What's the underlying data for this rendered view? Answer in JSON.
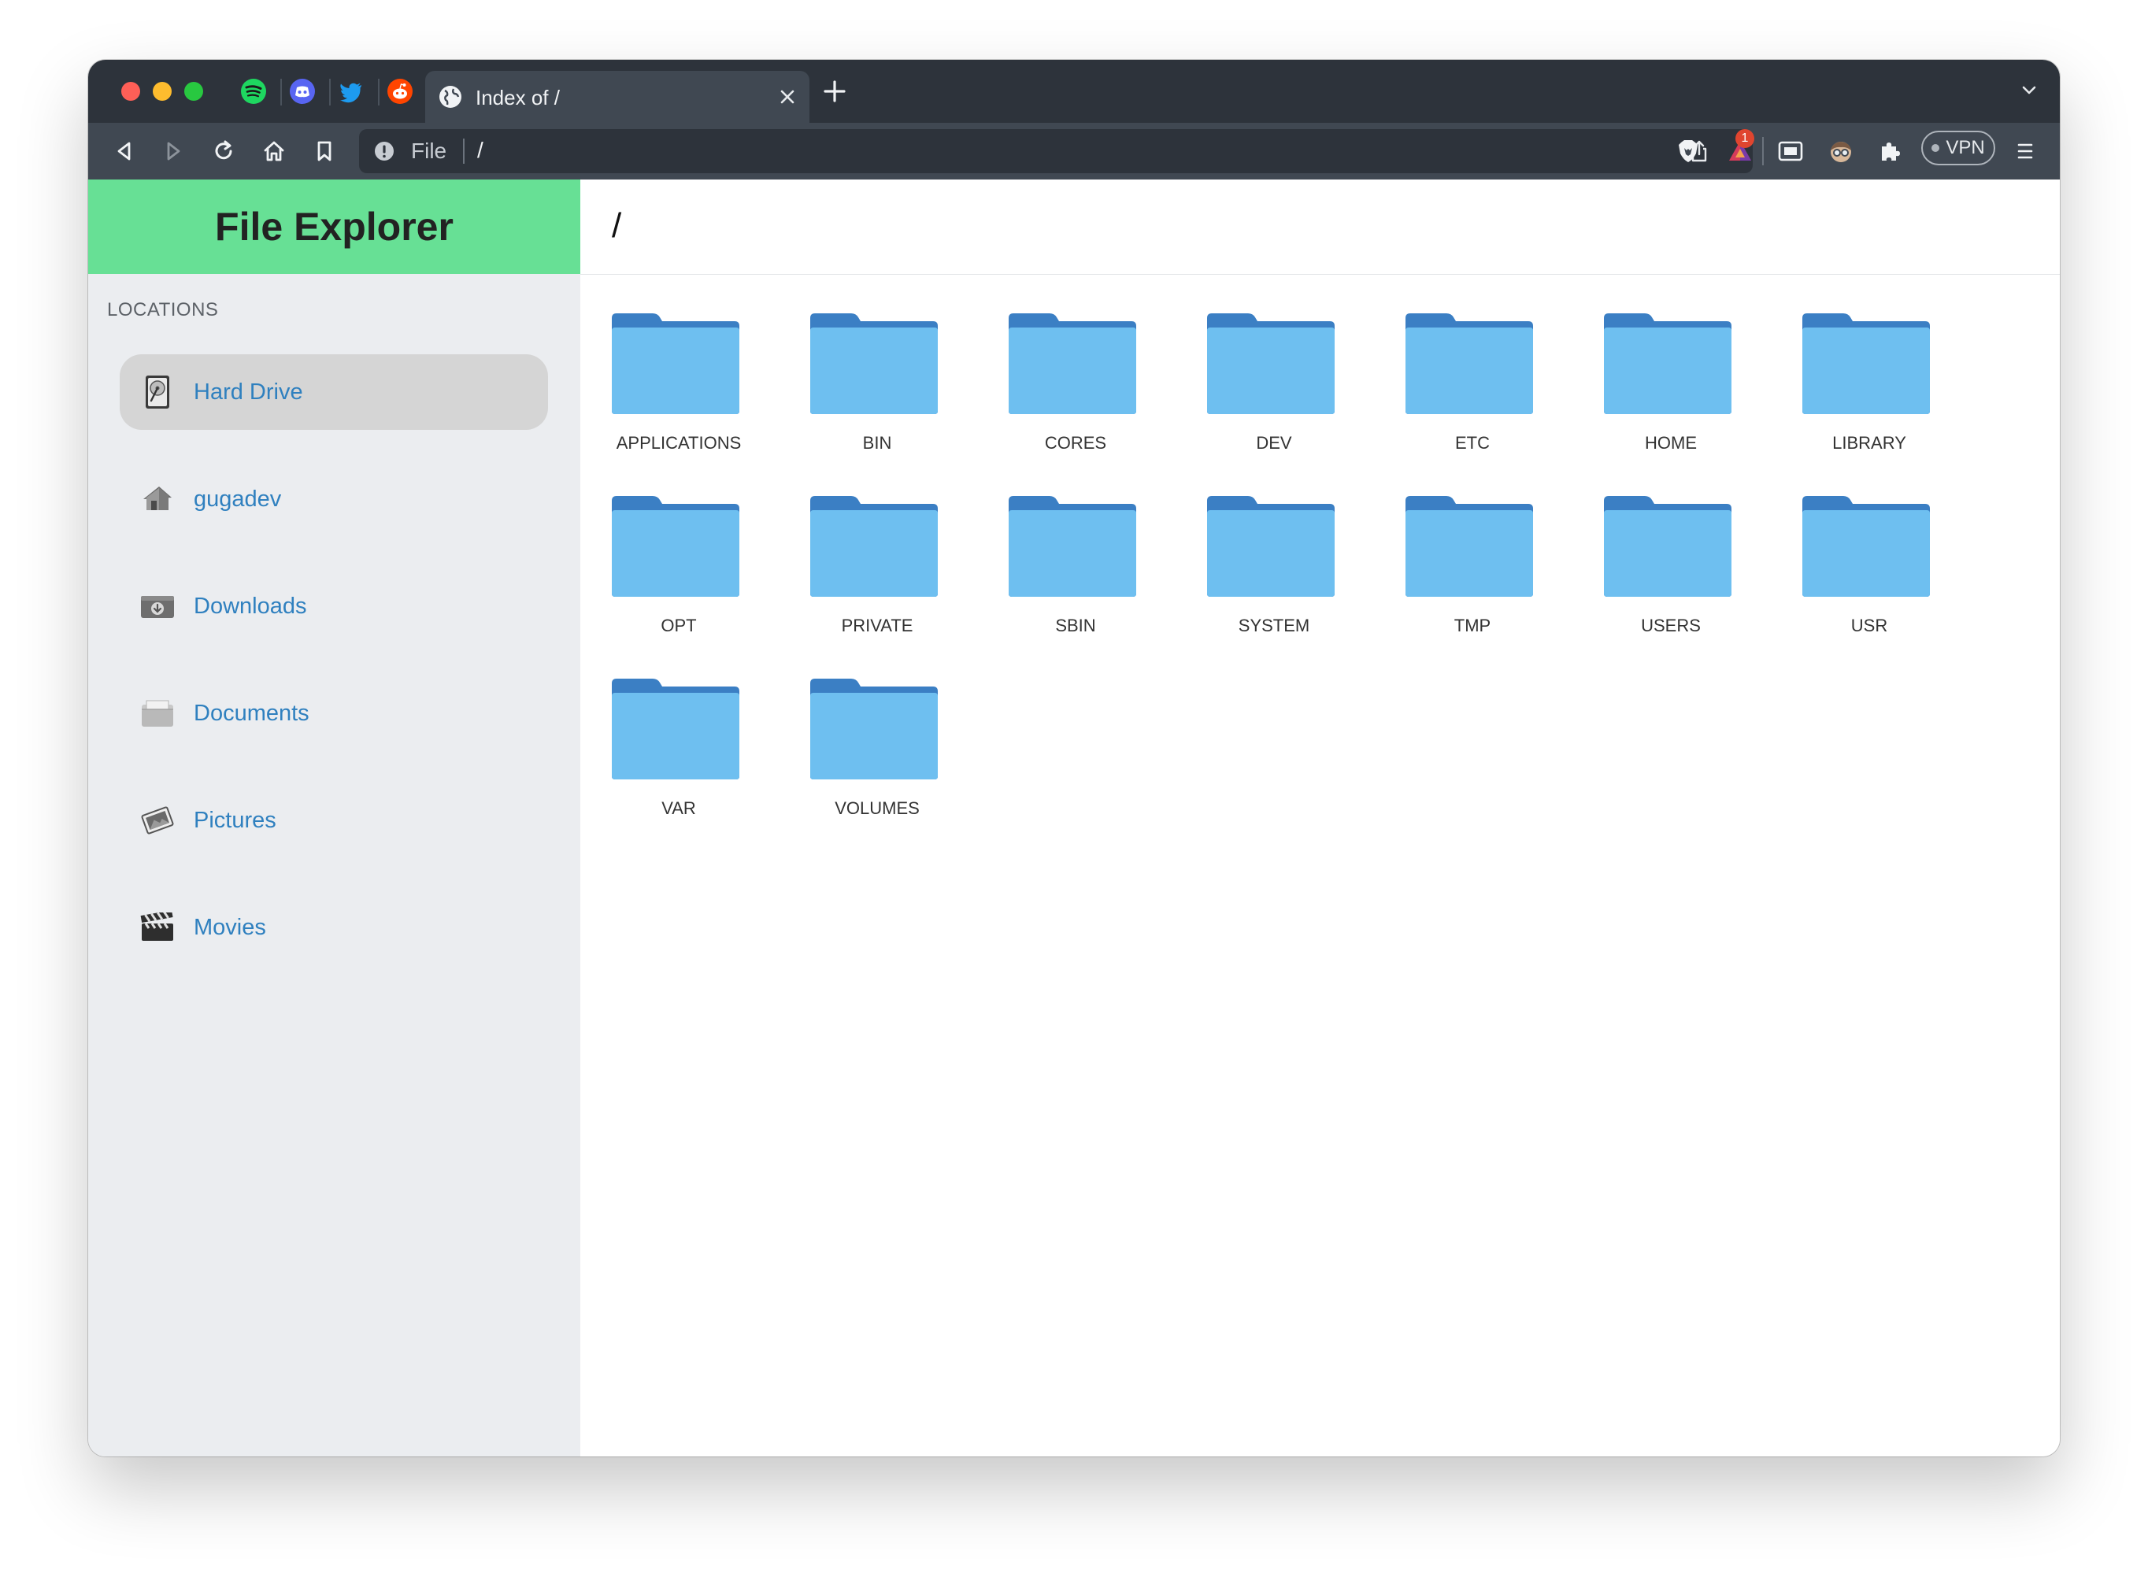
{
  "browser": {
    "pinned_tabs": [
      {
        "name": "spotify-tab",
        "icon": "spotify-icon",
        "color": "#1ed760"
      },
      {
        "name": "discord-tab",
        "icon": "discord-icon",
        "color": "#5865f2"
      },
      {
        "name": "twitter-tab",
        "icon": "twitter-icon",
        "color": "#1d9bf0"
      },
      {
        "name": "reddit-tab",
        "icon": "reddit-icon",
        "color": "#ff4500"
      }
    ],
    "active_tab": {
      "title": "Index of /",
      "icon": "globe-icon"
    },
    "url": {
      "scheme": "File",
      "path": "/"
    },
    "notification_count": "1",
    "vpn_label": "VPN"
  },
  "sidebar": {
    "title": "File Explorer",
    "section_heading": "LOCATIONS",
    "items": [
      {
        "label": "Hard Drive",
        "icon": "hard-drive-icon",
        "active": true
      },
      {
        "label": "gugadev",
        "icon": "home-icon",
        "active": false
      },
      {
        "label": "Downloads",
        "icon": "downloads-icon",
        "active": false
      },
      {
        "label": "Documents",
        "icon": "documents-icon",
        "active": false
      },
      {
        "label": "Pictures",
        "icon": "pictures-icon",
        "active": false
      },
      {
        "label": "Movies",
        "icon": "movies-icon",
        "active": false
      }
    ]
  },
  "main": {
    "path": "/",
    "folders": [
      "APPLICATIONS",
      "BIN",
      "CORES",
      "DEV",
      "ETC",
      "HOME",
      "LIBRARY",
      "OPT",
      "PRIVATE",
      "SBIN",
      "SYSTEM",
      "TMP",
      "USERS",
      "USR",
      "VAR",
      "VOLUMES"
    ]
  },
  "colors": {
    "brand": "#67e095",
    "sidebar_bg": "#ebedf0",
    "link": "#2f80bf",
    "folder_light": "#6ebff0",
    "folder_dark": "#3b7fc4",
    "browser_dark": "#2d333b",
    "browser_mid": "#404852"
  }
}
